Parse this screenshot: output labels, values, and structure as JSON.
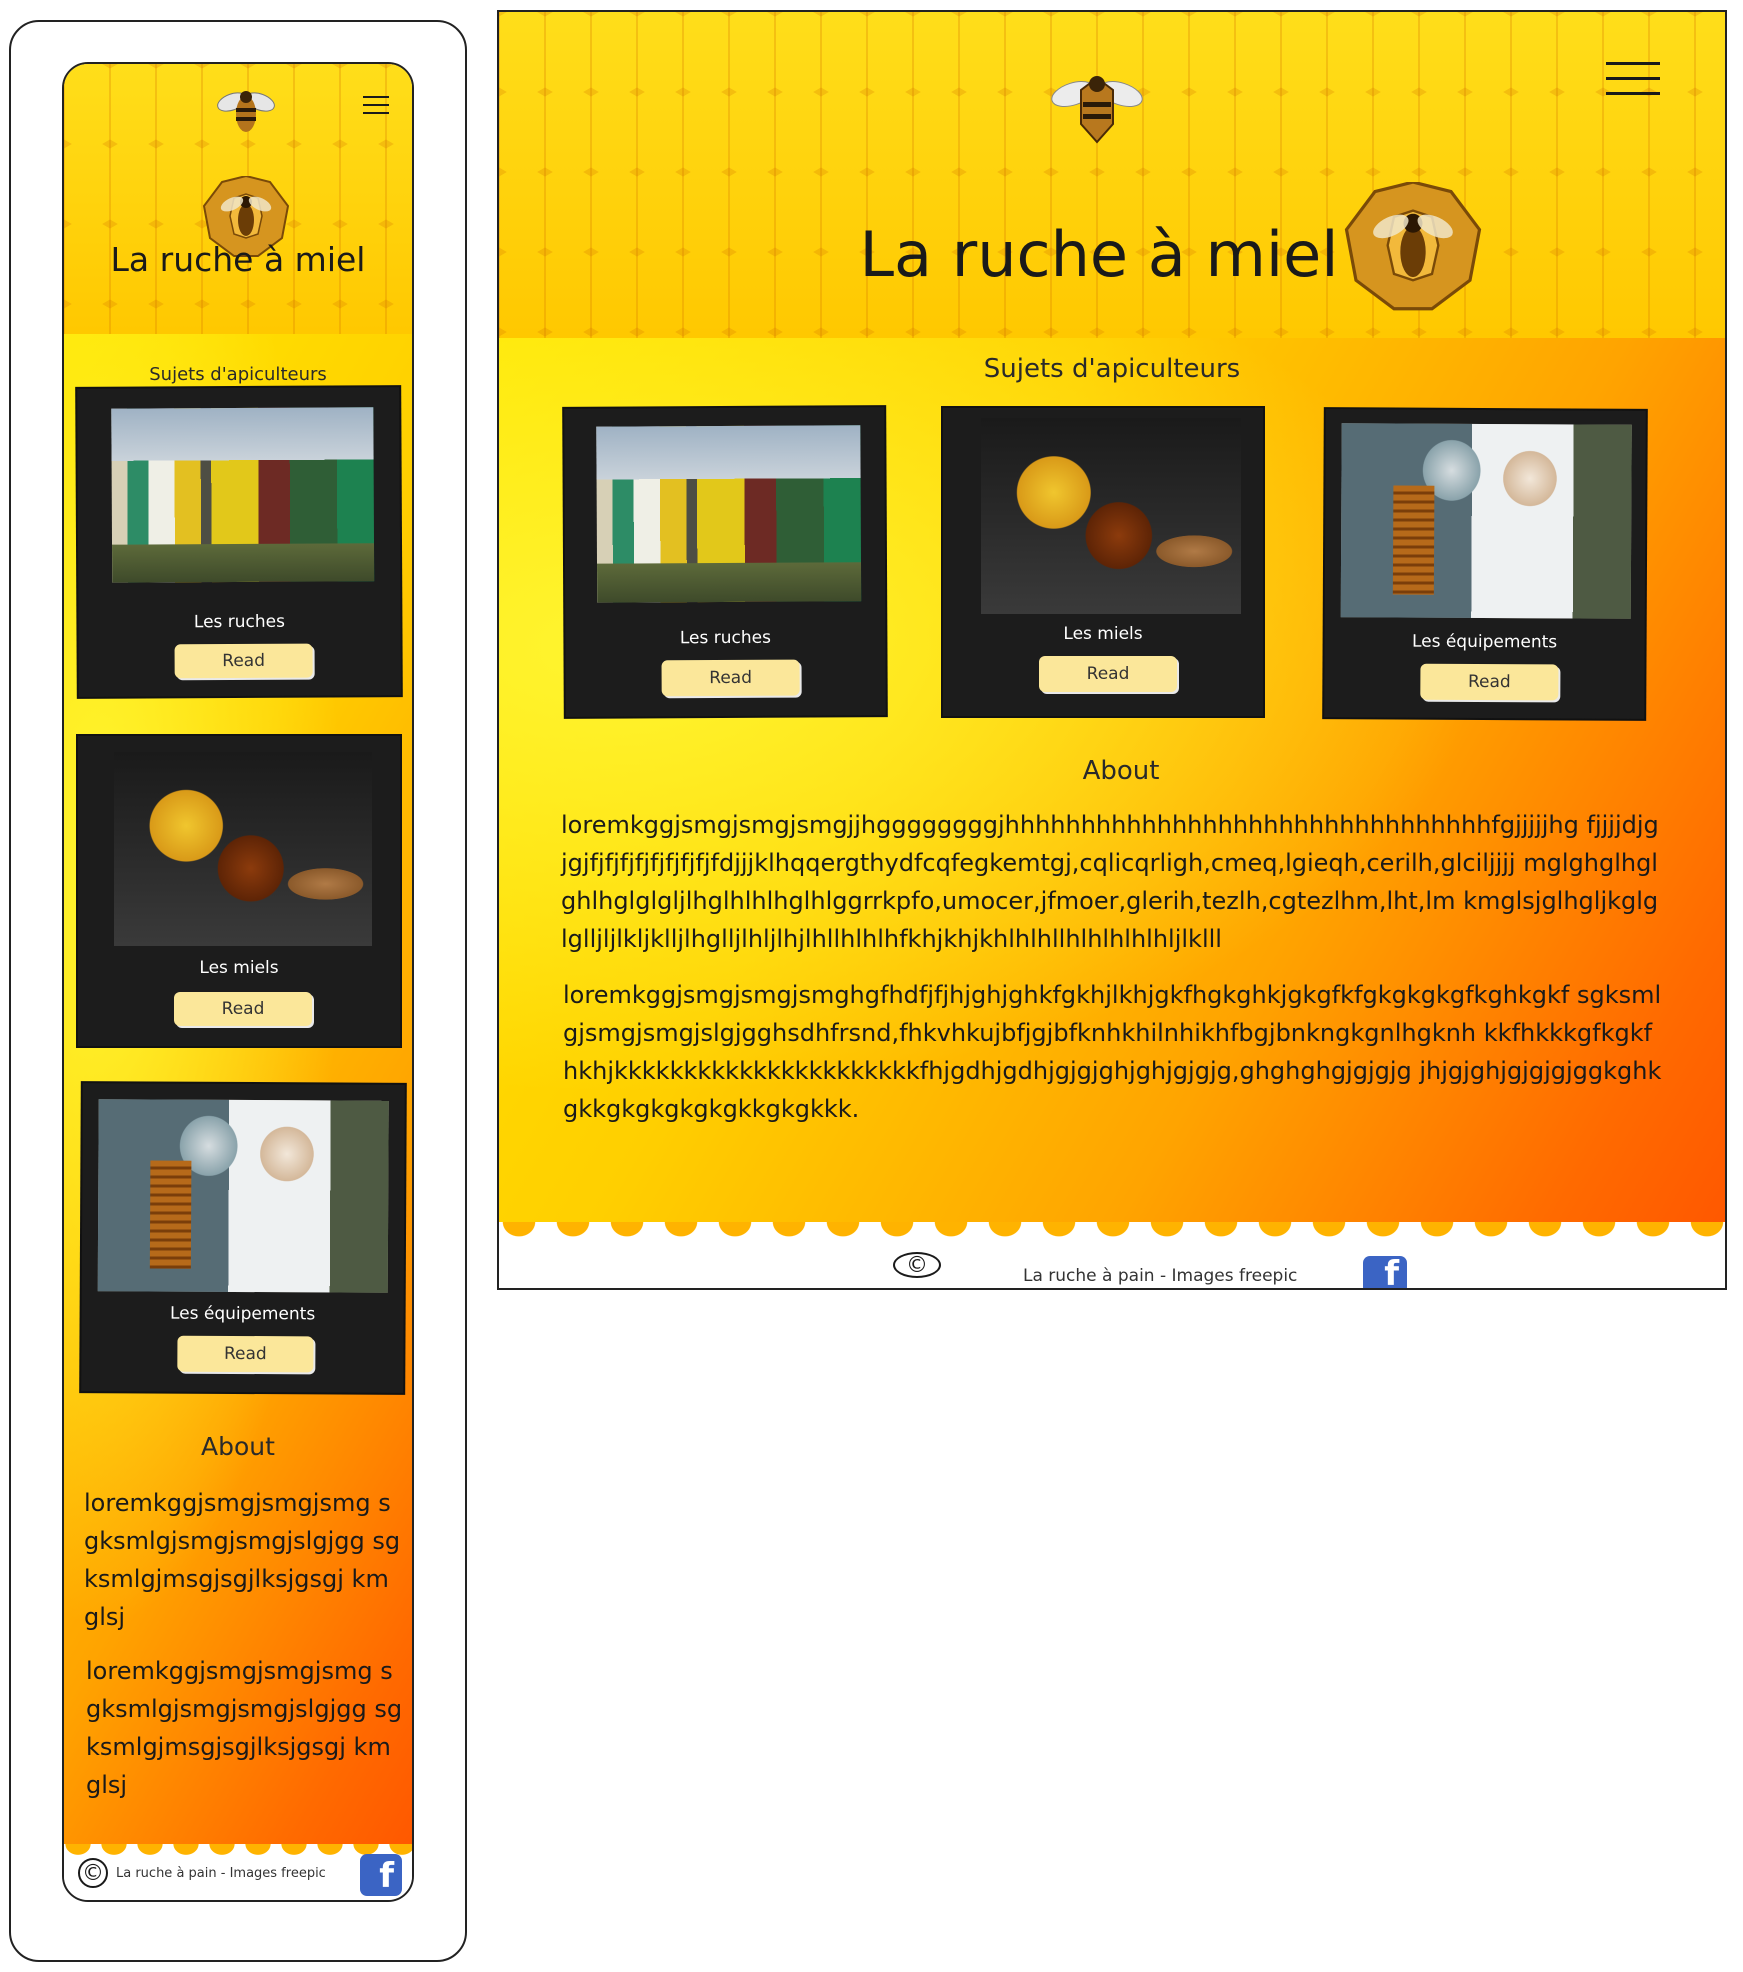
{
  "site": {
    "title": "La ruche à miel",
    "section_title": "Sujets d'apiculteurs",
    "about_title": "About",
    "footer_text": "La ruche à pain - Images freepic",
    "copyright_symbol": "©",
    "facebook_glyph": "f"
  },
  "cards": [
    {
      "title": "Les ruches",
      "button": "Read",
      "image": "beehives-photo"
    },
    {
      "title": "Les miels",
      "button": "Read",
      "image": "honey-jars-photo"
    },
    {
      "title": "Les équipements",
      "button": "Read",
      "image": "beekeepers-photo"
    }
  ],
  "desktop": {
    "about_paragraphs": [
      "loremkggjsmgjsmgjsmgjjhggggggggjhhhhhhhhhhhhhhhhhhhhhhhhhhhhhhhhfgjjjjjhg fjjjjdjgjgjfjfjfjfjfjfjfjfjfdjjjklhqqergthydfcqfegkemtgj,cqlicqrligh,cmeq,lgieqh,cerilh,glciljjjj mglghglhglghlhglglgljlhglhlhlhglhlggrrkpfo,umocer,jfmoer,glerih,tezlh,cgtezlhm,lht,lm kmglsjglhgljkglglglljljlkljklljlhglljlhljlhjlhllhlhlhfkhjkhjkhlhlhllhlhlhlhlhljlklll",
      "loremkggjsmgjsmgjsmghgfhdfjfjhjghjghkfgkhjlkhjgkfhgkghkjgkgfkfgkgkgkgfkghkgkf sgksmlgjsmgjsmgjslgjgghsdhfrsnd,fhkvhkujbfjgjbfknhkhilnhikhfbgjbnkngkgnlhgknh kkfhkkkgfkgkfhkhjkkkkkkkkkkkkkkkkkkkkkkfhjgdhjgdhjgjgjghjghjgjgjg,ghghghgjgjgjg jhjgjghjgjgjgjggkghkgkkgkgkgkgkgkkgkgkkk."
    ]
  },
  "mobile": {
    "about_paragraphs": [
      "loremkggjsmgjsmgjsmg sgksmlgjsmgjsmgjslgjgg sgksmlgjmsgjsgjlksjgsgj kmglsj",
      "loremkggjsmgjsmgjsmg sgksmlgjsmgjsmgjslgjgg sgksmlgjmsgjsgjlksjgsgj kmglsj"
    ]
  },
  "colors": {
    "header_yellow": "#ffd200",
    "card_dark": "#1c1c1c",
    "button_cream": "#fbe79a",
    "facebook_blue": "#3b64c4",
    "gradient_orange": "#ff5800"
  },
  "icons": [
    "bee-icon",
    "honeycomb-bee-icon",
    "hamburger-menu-icon",
    "copyright-icon",
    "facebook-icon"
  ]
}
